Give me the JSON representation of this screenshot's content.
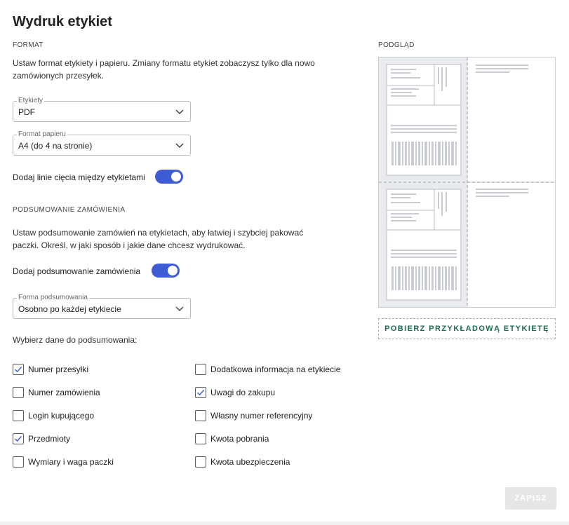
{
  "page": {
    "title": "Wydruk etykiet"
  },
  "format": {
    "heading": "FORMAT",
    "description": "Ustaw format etykiety i papieru. Zmiany formatu etykiet zobaczysz tylko dla nowo zamówionych przesyłek.",
    "labels_field": {
      "label": "Etykiety",
      "value": "PDF"
    },
    "paper_field": {
      "label": "Format papieru",
      "value": "A4 (do 4 na stronie)"
    },
    "cut_lines": {
      "label": "Dodaj linie cięcia między etykietami",
      "on": true
    }
  },
  "summary": {
    "heading": "PODSUMOWANIE ZAMÓWIENIA",
    "description": "Ustaw podsumowanie zamówień na etykietach, aby łatwiej i szybciej pakować paczki. Określ, w jaki sposób i jakie dane chcesz wydrukować.",
    "add_summary": {
      "label": "Dodaj podsumowanie zamówienia",
      "on": true
    },
    "form_field": {
      "label": "Forma podsumowania",
      "value": "Osobno po każdej etykiecie"
    },
    "choose_label": "Wybierz dane do podsumowania:",
    "options_left": [
      {
        "label": "Numer przesyłki",
        "checked": true
      },
      {
        "label": "Numer zamówienia",
        "checked": false
      },
      {
        "label": "Login kupującego",
        "checked": false
      },
      {
        "label": "Przedmioty",
        "checked": true
      },
      {
        "label": "Wymiary i waga paczki",
        "checked": false
      }
    ],
    "options_right": [
      {
        "label": "Dodatkowa informacja na etykiecie",
        "checked": false
      },
      {
        "label": "Uwagi do zakupu",
        "checked": true
      },
      {
        "label": "Własny numer referencyjny",
        "checked": false
      },
      {
        "label": "Kwota pobrania",
        "checked": false
      },
      {
        "label": "Kwota ubezpieczenia",
        "checked": false
      }
    ]
  },
  "preview": {
    "heading": "PODGLĄD",
    "download_label": "POBIERZ PRZYKŁADOWĄ ETYKIETĘ"
  },
  "actions": {
    "save_label": "ZAPISZ"
  },
  "colors": {
    "accent": "#3f5bd5",
    "download_text": "#1f6b52",
    "save_disabled": "#e6e6e6"
  }
}
